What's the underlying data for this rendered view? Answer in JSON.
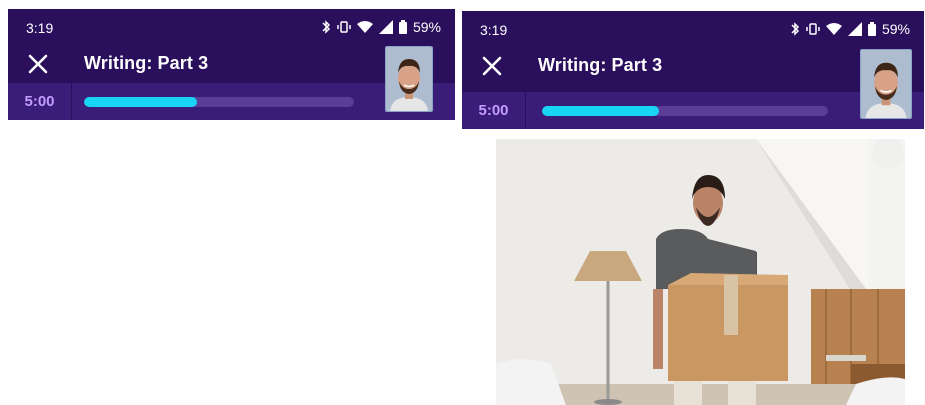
{
  "left_screen": {
    "status": {
      "time": "3:19",
      "battery": "59%"
    },
    "header": {
      "title": "Writing: Part 3"
    },
    "progress": {
      "timer": "5:00",
      "fraction": 0.42
    }
  },
  "right_screen": {
    "status": {
      "time": "3:19",
      "battery": "59%"
    },
    "header": {
      "title": "Writing: Part 3"
    },
    "progress": {
      "timer": "5:00",
      "fraction": 0.41
    }
  },
  "icons": {
    "bluetooth": "bluetooth-icon",
    "vibrate": "vibrate-icon",
    "wifi": "wifi-icon",
    "signal": "signal-icon",
    "battery": "battery-icon",
    "close": "close-icon"
  },
  "colors": {
    "header_bg": "#2a0f5c",
    "progress_bg": "#3a1d78",
    "timer_text": "#c39cff",
    "progress_fill": "#18d4f5"
  }
}
